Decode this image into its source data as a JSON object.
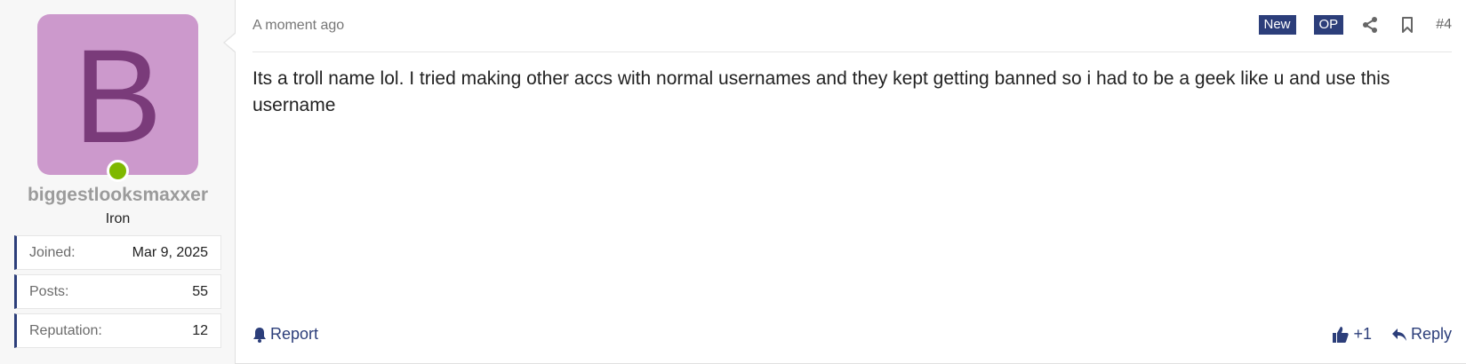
{
  "user": {
    "avatar_letter": "B",
    "avatar_color": "#cc99cc",
    "avatar_letter_color": "#7a3b7a",
    "online_status_color": "#7fb800",
    "name": "biggestlooksmaxxer",
    "rank": "Iron",
    "stats": [
      {
        "label": "Joined:",
        "value": "Mar 9, 2025"
      },
      {
        "label": "Posts:",
        "value": "55"
      },
      {
        "label": "Reputation:",
        "value": "12"
      }
    ]
  },
  "header": {
    "timestamp": "A moment ago",
    "badge_new": "New",
    "badge_op": "OP",
    "share_icon": "share-icon",
    "bookmark_icon": "bookmark-icon",
    "post_number": "#4"
  },
  "message": {
    "text": "Its a troll name lol. I tried making other accs with normal usernames and they kept getting banned so i had to be a geek like u and use this username"
  },
  "footer": {
    "report_label": "Report",
    "like_label": "+1",
    "reply_label": "Reply",
    "accent_color": "#2c3e7a"
  }
}
